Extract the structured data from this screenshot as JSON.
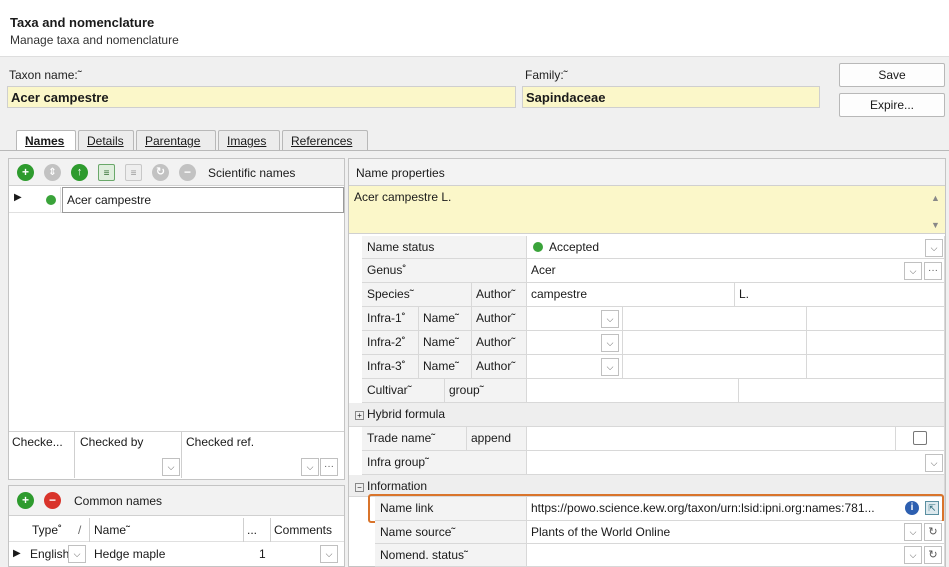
{
  "header": {
    "title": "Taxa and nomenclature",
    "subtitle": "Manage taxa and nomenclature"
  },
  "taxon": {
    "label": "Taxon name:˜",
    "value": "Acer campestre"
  },
  "family": {
    "label": "Family:˜",
    "value": "Sapindaceae"
  },
  "buttons": {
    "save": "Save",
    "expire": "Expire..."
  },
  "tabs": [
    {
      "label": "Names"
    },
    {
      "label": "Details"
    },
    {
      "label": "Parentage"
    },
    {
      "label": "Images"
    },
    {
      "label": "References"
    }
  ],
  "scientific": {
    "toolbar_label": "Scientific names",
    "rows": [
      {
        "name": "Acer campestre"
      }
    ]
  },
  "checked": {
    "col1": "Checke...",
    "col2": "Checked by",
    "col3": "Checked ref."
  },
  "common": {
    "toolbar_label": "Common names",
    "headers": {
      "type": "Type˚",
      "slash": "/",
      "name": "Name˜",
      "dots": "...",
      "comments": "Comments"
    },
    "rows": [
      {
        "type": "English",
        "name": "Hedge maple",
        "count": "1"
      }
    ]
  },
  "props": {
    "header": "Name properties",
    "text": "Acer campestre L.",
    "name_status": {
      "label": "Name status",
      "value": "Accepted",
      "status_color": "#3aa33a"
    },
    "genus": {
      "label": "Genus˚",
      "value": "Acer"
    },
    "species": {
      "label": "Species˜",
      "author_label": "Author˜",
      "value": "campestre",
      "author": "L."
    },
    "infra1": {
      "label": "Infra-1˚",
      "name_label": "Name˜",
      "author_label": "Author˜"
    },
    "infra2": {
      "label": "Infra-2˚",
      "name_label": "Name˜",
      "author_label": "Author˜"
    },
    "infra3": {
      "label": "Infra-3˚",
      "name_label": "Name˜",
      "author_label": "Author˜"
    },
    "cultivar": {
      "label": "Cultivar˜",
      "group_label": "group˜"
    },
    "hybrid": {
      "label": "Hybrid formula"
    },
    "trade": {
      "label": "Trade name˜",
      "append_label": "append"
    },
    "infra_group": {
      "label": "Infra group˜"
    },
    "information": {
      "label": "Information"
    },
    "name_link": {
      "label": "Name link",
      "value": "https://powo.science.kew.org/taxon/urn:lsid:ipni.org:names:781..."
    },
    "name_source": {
      "label": "Name source˜",
      "value": "Plants of the World Online"
    },
    "nomend_status": {
      "label": "Nomend. status˜"
    }
  },
  "colors": {
    "highlight": "#d9742b",
    "field_yellow": "#fbf7c9",
    "green": "#2e9b2e",
    "red": "#d9342b"
  },
  "icons": {
    "sci_toolbar": [
      "add-icon",
      "move-icon",
      "up-icon",
      "list-icon",
      "list-icon",
      "refresh-icon",
      "remove-icon"
    ],
    "common_toolbar": [
      "add-icon",
      "remove-icon"
    ]
  }
}
